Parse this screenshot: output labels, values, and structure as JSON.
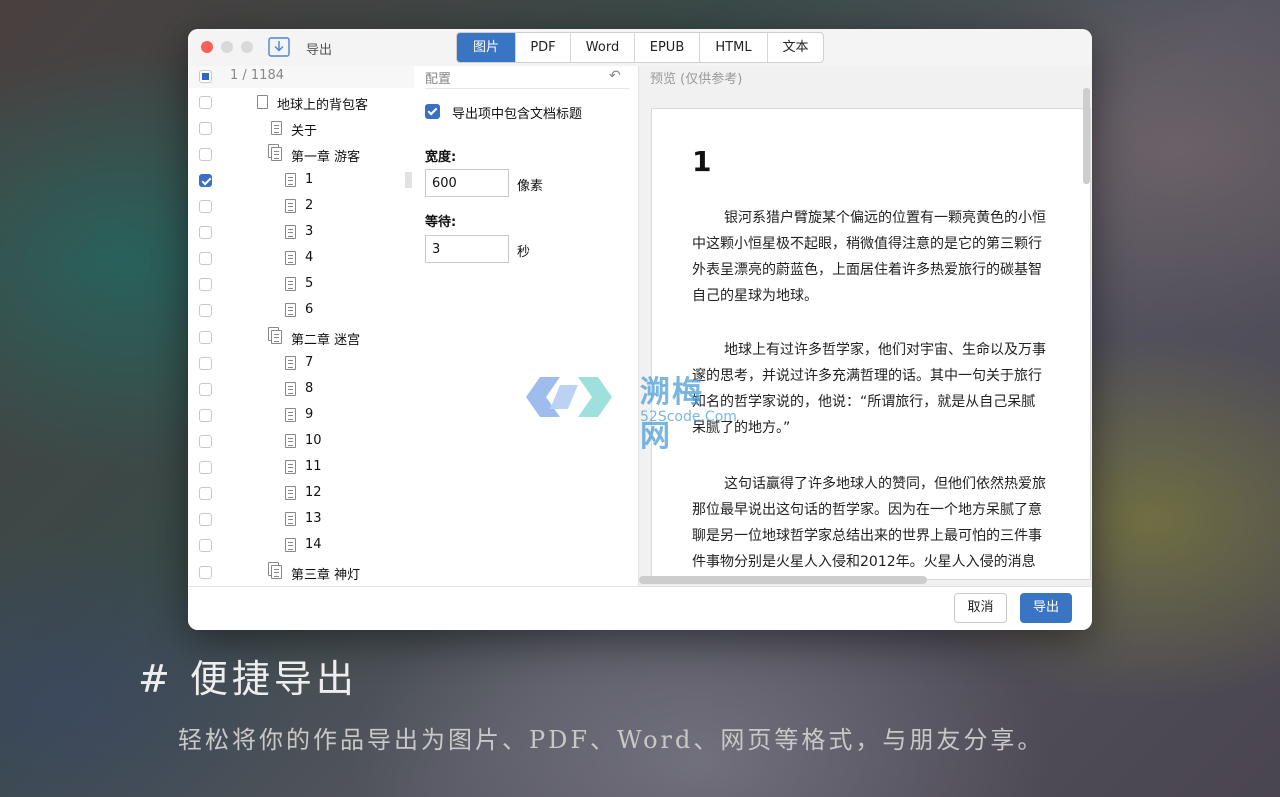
{
  "window": {
    "title": "导出",
    "tabs": [
      {
        "label": "图片",
        "active": true
      },
      {
        "label": "PDF",
        "active": false
      },
      {
        "label": "Word",
        "active": false
      },
      {
        "label": "EPUB",
        "active": false
      },
      {
        "label": "HTML",
        "active": false
      },
      {
        "label": "文本",
        "active": false
      }
    ]
  },
  "tree": {
    "counter": "1 / 1184",
    "items": [
      {
        "label": "地球上的背包客",
        "checked": false
      },
      {
        "label": "关于",
        "checked": false
      },
      {
        "label": "第一章 游客",
        "checked": false
      },
      {
        "label": "1",
        "checked": true
      },
      {
        "label": "2",
        "checked": false
      },
      {
        "label": "3",
        "checked": false
      },
      {
        "label": "4",
        "checked": false
      },
      {
        "label": "5",
        "checked": false
      },
      {
        "label": "6",
        "checked": false
      },
      {
        "label": "第二章 迷宫",
        "checked": false
      },
      {
        "label": "7",
        "checked": false
      },
      {
        "label": "8",
        "checked": false
      },
      {
        "label": "9",
        "checked": false
      },
      {
        "label": "10",
        "checked": false
      },
      {
        "label": "11",
        "checked": false
      },
      {
        "label": "12",
        "checked": false
      },
      {
        "label": "13",
        "checked": false
      },
      {
        "label": "14",
        "checked": false
      },
      {
        "label": "第三章 神灯",
        "checked": false
      }
    ]
  },
  "config": {
    "title": "配置",
    "include_title_label": "导出项中包含文档标题",
    "include_title_checked": true,
    "width_label": "宽度:",
    "width_value": "600",
    "width_unit": "像素",
    "wait_label": "等待:",
    "wait_value": "3",
    "wait_unit": "秒"
  },
  "preview": {
    "title": "预览 (仅供参考)",
    "heading": "1",
    "para1": [
      "银河系猎户臂旋某个偏远的位置有一颗亮黄色的小恒",
      "中这颗小恒星极不起眼，稍微值得注意的是它的第三颗行",
      "外表呈漂亮的蔚蓝色，上面居住着许多热爱旅行的碳基智",
      "自己的星球为地球。"
    ],
    "para2": [
      "地球上有过许多哲学家，他们对宇宙、生命以及万事",
      "邃的思考，并说过许多充满哲理的话。其中一句关于旅行",
      "知名的哲学家说的，他说：“所谓旅行，就是从自己呆腻",
      "呆腻了的地方。”"
    ],
    "para3": [
      "这句话赢得了许多地球人的赞同，但他们依然热爱旅",
      "那位最早说出这句话的哲学家。因为在一个地方呆腻了意",
      "聊是另一位地球哲学家总结出来的世界上最可怕的三件事",
      "件事物分别是火星人入侵和2012年。火星人入侵的消息"
    ]
  },
  "footer": {
    "cancel_label": "取消",
    "ok_label": "导出"
  },
  "watermark": {
    "text": "溯梅网",
    "sub": "52Scode.Com"
  },
  "promo": {
    "title": "# 便捷导出",
    "subtitle": "轻松将你的作品导出为图片、PDF、Word、网页等格式，与朋友分享。"
  },
  "colors": {
    "accent": "#3a75c4",
    "close": "#fe5f57"
  }
}
